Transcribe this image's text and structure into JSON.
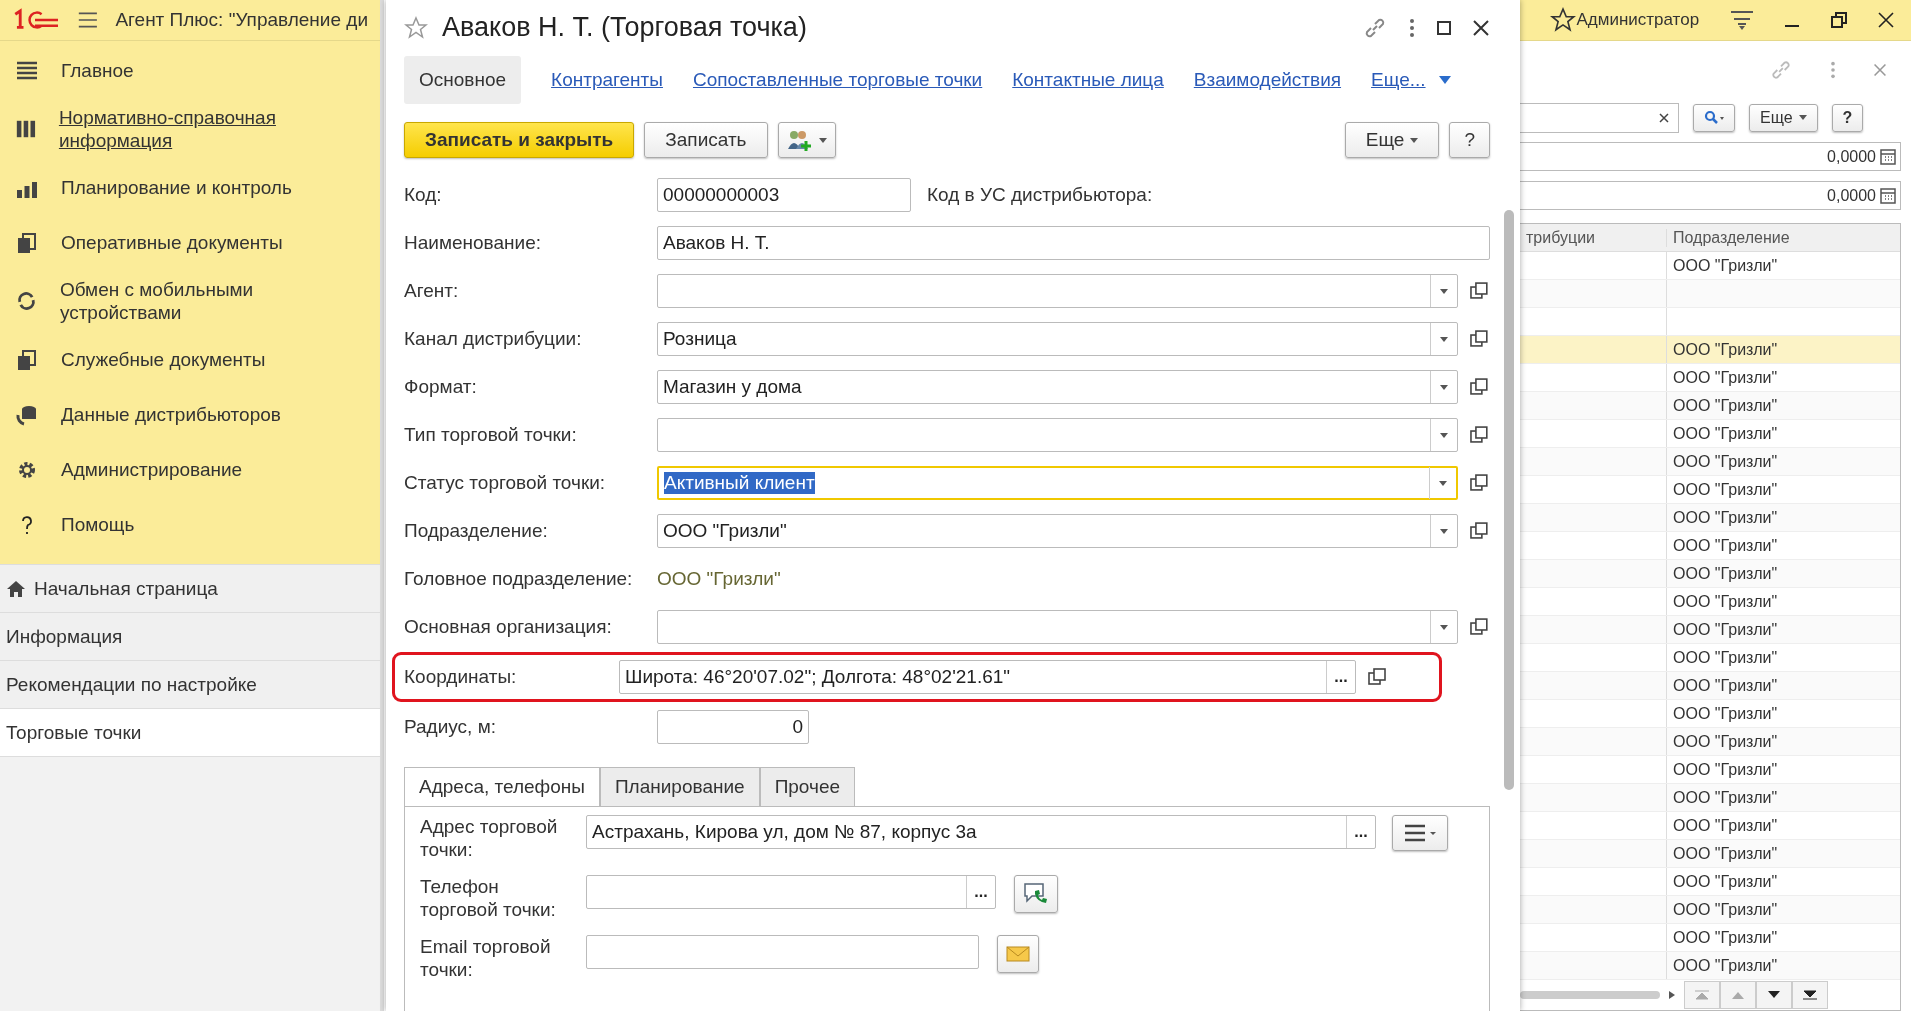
{
  "app": {
    "title": "Агент Плюс: \"Управление ди",
    "user": "Администратор"
  },
  "sections": [
    {
      "label": "Главное",
      "link": false
    },
    {
      "label": "Нормативно-справочная информация",
      "link": true
    },
    {
      "label": "Планирование и контроль",
      "link": false
    },
    {
      "label": "Оперативные документы",
      "link": false
    },
    {
      "label": "Обмен с мобильными устройствами",
      "link": false
    },
    {
      "label": "Служебные документы",
      "link": false
    },
    {
      "label": "Данные дистрибьюторов",
      "link": false
    },
    {
      "label": "Администрирование",
      "link": false
    },
    {
      "label": "Помощь",
      "link": false
    }
  ],
  "open_windows": [
    {
      "label": "Начальная страница",
      "home": true,
      "selected": false
    },
    {
      "label": "Информация",
      "home": false,
      "selected": false
    },
    {
      "label": "Рекомендации по настройке",
      "home": false,
      "selected": false
    },
    {
      "label": "Торговые точки",
      "home": false,
      "selected": true
    }
  ],
  "form": {
    "title": "Аваков Н. Т. (Торговая точка)",
    "nav": [
      {
        "label": "Основное",
        "selected": true
      },
      {
        "label": "Контрагенты",
        "selected": false
      },
      {
        "label": "Сопоставленные торговые точки",
        "selected": false
      },
      {
        "label": "Контактные лица",
        "selected": false
      },
      {
        "label": "Взаимодействия",
        "selected": false
      },
      {
        "label": "Еще...",
        "selected": false
      }
    ],
    "buttons": {
      "save_close": "Записать и закрыть",
      "save": "Записать",
      "more": "Еще",
      "help": "?"
    },
    "fields": [
      {
        "kind": "code",
        "label": "Код:",
        "value": "00000000003",
        "extra_label": "Код в УС дистрибьютора:"
      },
      {
        "kind": "text",
        "label": "Наименование:",
        "value": "Аваков Н. Т."
      },
      {
        "kind": "select",
        "label": "Агент:"
      },
      {
        "kind": "select",
        "label": "Канал дистрибуции:",
        "value": "Розница"
      },
      {
        "kind": "select",
        "label": "Формат:",
        "value": "Магазин у дома"
      },
      {
        "kind": "select",
        "label": "Тип торговой точки:"
      },
      {
        "kind": "select",
        "label": "Статус торговой точки:",
        "value": "Активный клиент",
        "focused": true
      },
      {
        "kind": "select",
        "label": "Подразделение:",
        "value": "ООО \"Гризли\""
      },
      {
        "kind": "static",
        "label": "Головное подразделение:",
        "value": "ООО \"Гризли\""
      },
      {
        "kind": "select",
        "label": "Основная организация:"
      },
      {
        "kind": "picker",
        "label": "Координаты:",
        "value": "Широта: 46°20'07.02\"; Долгота: 48°02'21.61\"",
        "highlighted": true,
        "picker_text": "..."
      },
      {
        "kind": "number",
        "label": "Радиус, м:",
        "value": "0"
      }
    ],
    "tabs": [
      {
        "label": "Адреса, телефоны",
        "selected": true
      },
      {
        "label": "Планирование",
        "selected": false
      },
      {
        "label": "Прочее",
        "selected": false
      }
    ],
    "contacts": [
      {
        "kind": "address",
        "label": "Адрес торговой точки:",
        "value": "Астрахань, Кирова ул, дом № 87, корпус 3а",
        "picker_text": "..."
      },
      {
        "kind": "phone",
        "label": "Телефон торговой точки:",
        "picker_text": "..."
      },
      {
        "kind": "email",
        "label": "Email торговой точки:"
      }
    ]
  },
  "list": {
    "more": "Еще",
    "help": "?",
    "amounts": [
      "0,0000",
      "0,0000"
    ],
    "columns": [
      "трибуции",
      "Подразделение"
    ],
    "rows": [
      {
        "unit": "ООО \"Гризли\"",
        "selected": false
      },
      {
        "selected": false
      },
      {
        "selected": false
      },
      {
        "unit": "ООО \"Гризли\"",
        "selected": true
      },
      {
        "unit": "ООО \"Гризли\"",
        "selected": false
      },
      {
        "unit": "ООО \"Гризли\"",
        "selected": false
      },
      {
        "unit": "ООО \"Гризли\"",
        "selected": false
      },
      {
        "unit": "ООО \"Гризли\"",
        "selected": false
      },
      {
        "unit": "ООО \"Гризли\"",
        "selected": false
      },
      {
        "unit": "ООО \"Гризли\"",
        "selected": false
      },
      {
        "unit": "ООО \"Гризли\"",
        "selected": false
      },
      {
        "unit": "ООО \"Гризли\"",
        "selected": false
      },
      {
        "unit": "ООО \"Гризли\"",
        "selected": false
      },
      {
        "unit": "ООО \"Гризли\"",
        "selected": false
      },
      {
        "unit": "ООО \"Гризли\"",
        "selected": false
      },
      {
        "unit": "ООО \"Гризли\"",
        "selected": false
      },
      {
        "unit": "ООО \"Гризли\"",
        "selected": false
      },
      {
        "unit": "ООО \"Гризли\"",
        "selected": false
      },
      {
        "unit": "ООО \"Гризли\"",
        "selected": false
      },
      {
        "unit": "ООО \"Гризли\"",
        "selected": false
      },
      {
        "unit": "ООО \"Гризли\"",
        "selected": false
      },
      {
        "unit": "ООО \"Гризли\"",
        "selected": false
      },
      {
        "unit": "ООО \"Гризли\"",
        "selected": false
      },
      {
        "unit": "ООО \"Гризли\"",
        "selected": false
      },
      {
        "unit": "ООО \"Гризли\"",
        "selected": false
      },
      {
        "unit": "ООО \"Гризли\"",
        "selected": false
      }
    ]
  }
}
